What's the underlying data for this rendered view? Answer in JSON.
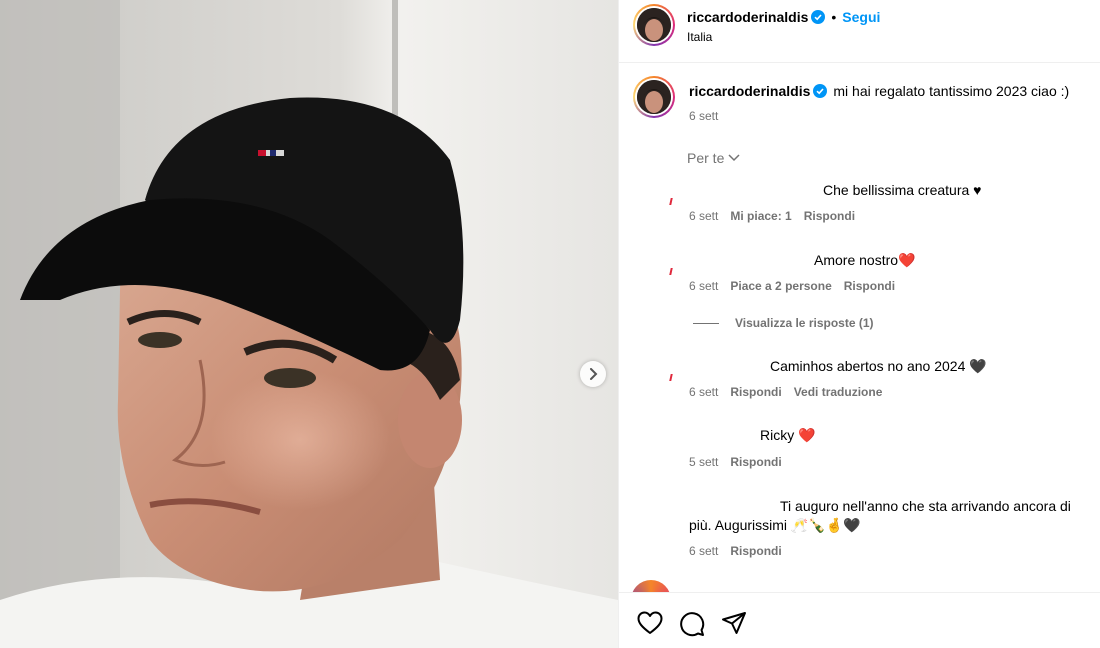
{
  "post": {
    "author": "riccardoderinaldis",
    "location": "Italia",
    "follow_label": "Segui",
    "separator": "•",
    "caption": "mi hai regalato tantissimo 2023 ciao :)",
    "caption_time": "6 sett",
    "sort_label": "Per te"
  },
  "comments": [
    {
      "text": "Che bellissima creatura ♥",
      "time": "6 sett",
      "likes": "Mi piace: 1",
      "reply": "Rispondi"
    },
    {
      "text": "Amore nostro❤️",
      "time": "6 sett",
      "likes": "Piace a 2 persone",
      "reply": "Rispondi",
      "view_replies": "Visualizza le risposte (1)"
    },
    {
      "text": "Caminhos abertos no ano 2024 🖤",
      "time": "6 sett",
      "reply": "Rispondi",
      "translate": "Vedi traduzione"
    },
    {
      "text": "Ricky ❤️",
      "time": "5 sett",
      "reply": "Rispondi"
    },
    {
      "text_line1": "Ti auguro nell'anno che sta arrivando ancora di",
      "text_line2": "più. Augurissimi 🥂🍾🤞🖤",
      "time": "6 sett",
      "reply": "Rispondi"
    }
  ],
  "icons": {
    "verified": "verified-badge-icon",
    "chevron": "chevron-down-icon",
    "next": "chevron-right-icon",
    "like": "heart-icon",
    "comment": "comment-icon",
    "share": "paper-plane-icon"
  },
  "colors": {
    "accent": "#0095f6",
    "meta_text": "#737373",
    "border": "#efefef"
  }
}
